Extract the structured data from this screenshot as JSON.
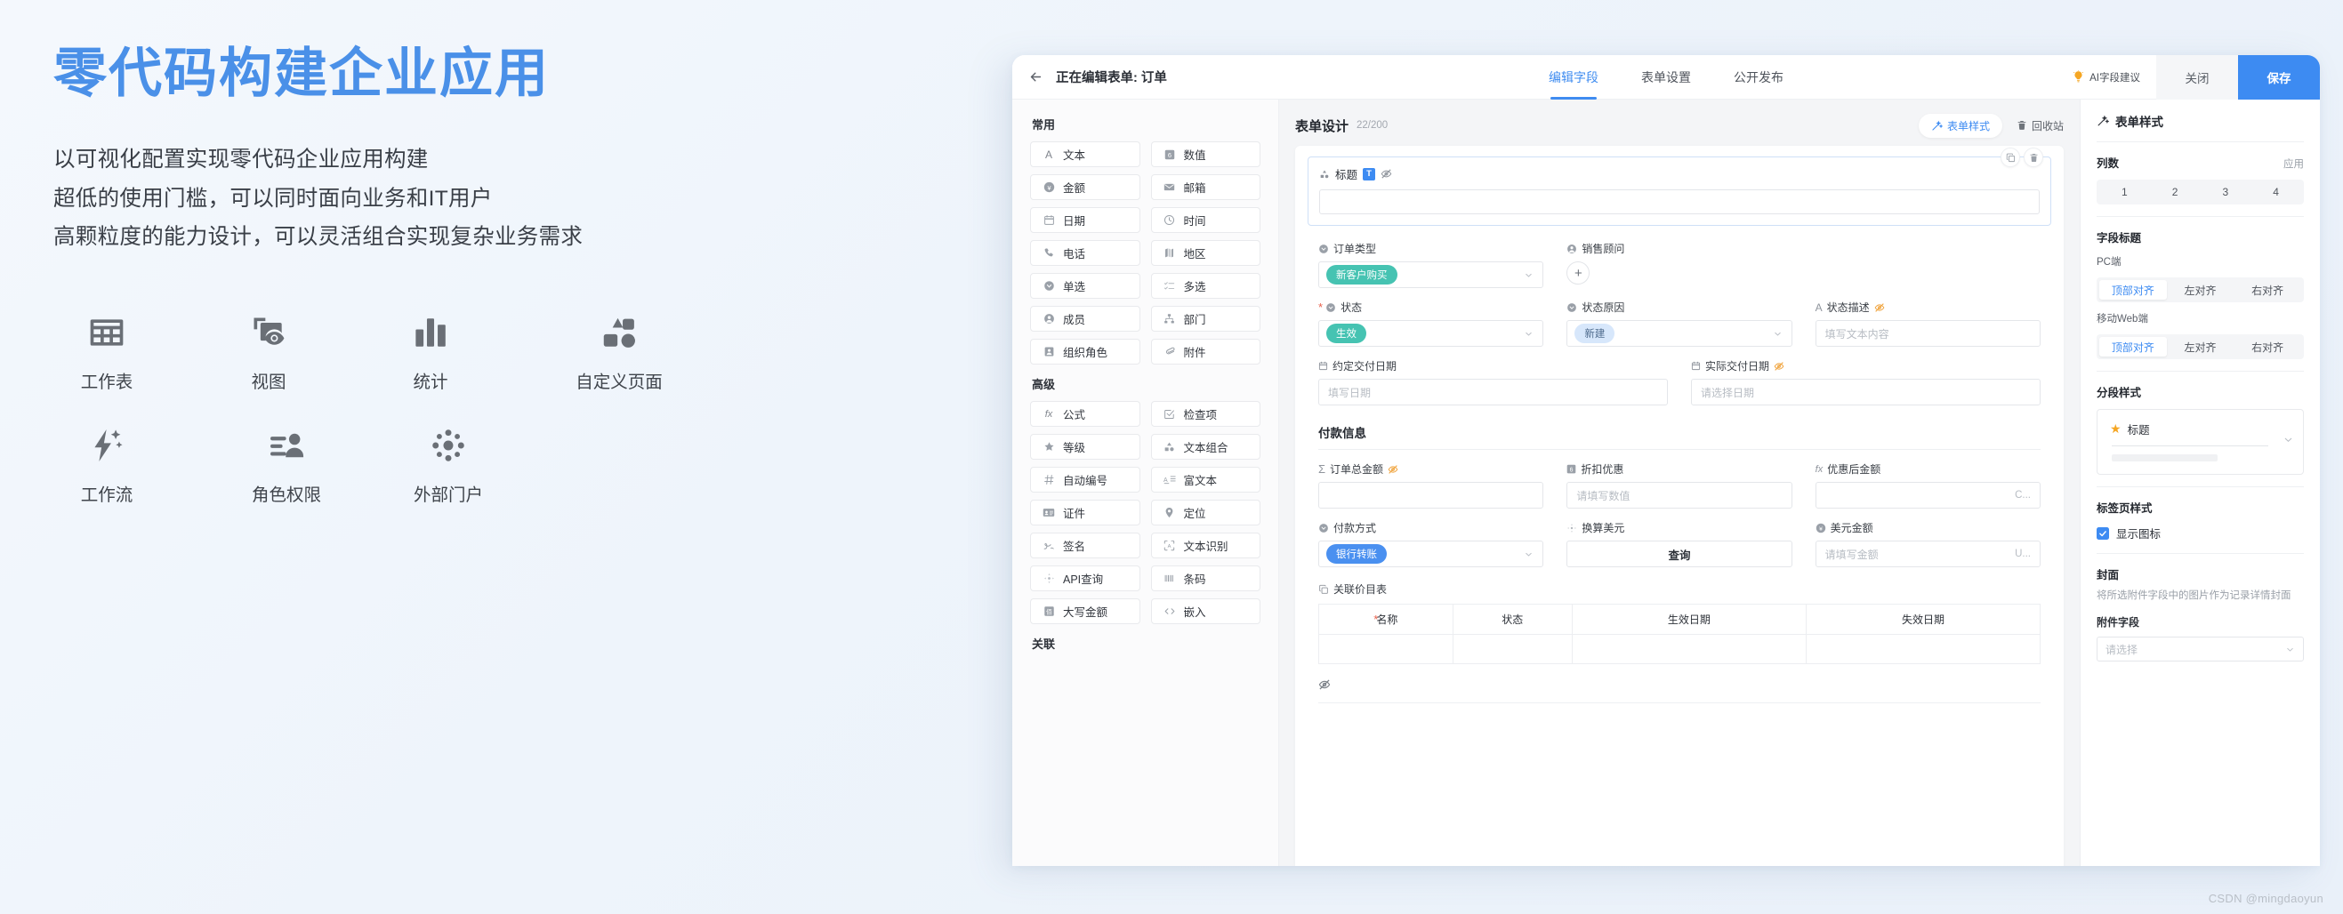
{
  "marketing": {
    "headline": "零代码构建企业应用",
    "sub_lines": [
      "以可视化配置实现零代码企业应用构建",
      "超低的使用门槛，可以同时面向业务和IT用户",
      "高颗粒度的能力设计，可以灵活组合实现复杂业务需求"
    ],
    "features": [
      {
        "icon": "worksheet-grid-icon",
        "label": "工作表"
      },
      {
        "icon": "view-eye-icon",
        "label": "视图"
      },
      {
        "icon": "statistics-bar-icon",
        "label": "统计"
      },
      {
        "icon": "custom-page-icon",
        "label": "自定义页面"
      },
      {
        "icon": "workflow-bolt-icon",
        "label": "工作流"
      },
      {
        "icon": "role-permission-icon",
        "label": "角色权限"
      },
      {
        "icon": "external-portal-icon",
        "label": "外部门户"
      }
    ]
  },
  "app": {
    "header": {
      "back_icon": "back-arrow-icon",
      "title": "正在编辑表单: 订单",
      "tabs": [
        {
          "label": "编辑字段",
          "active": true
        },
        {
          "label": "表单设置",
          "active": false
        },
        {
          "label": "公开发布",
          "active": false
        }
      ],
      "ai_suggest": "AI字段建议",
      "ai_icon": "lightbulb-icon",
      "close_label": "关闭",
      "save_label": "保存"
    },
    "palette": {
      "groups": [
        {
          "title": "常用",
          "items": [
            {
              "label": "文本",
              "icon": "letter-a-icon"
            },
            {
              "label": "数值",
              "icon": "number-box-icon"
            },
            {
              "label": "金额",
              "icon": "yuan-circle-icon"
            },
            {
              "label": "邮箱",
              "icon": "envelope-icon"
            },
            {
              "label": "日期",
              "icon": "calendar-icon"
            },
            {
              "label": "时间",
              "icon": "clock-icon"
            },
            {
              "label": "电话",
              "icon": "phone-icon"
            },
            {
              "label": "地区",
              "icon": "map-icon"
            },
            {
              "label": "单选",
              "icon": "radio-circle-icon"
            },
            {
              "label": "多选",
              "icon": "checklist-icon"
            },
            {
              "label": "成员",
              "icon": "user-circle-icon"
            },
            {
              "label": "部门",
              "icon": "org-tree-icon"
            },
            {
              "label": "组织角色",
              "icon": "id-person-icon"
            },
            {
              "label": "附件",
              "icon": "paperclip-icon"
            }
          ]
        },
        {
          "title": "高级",
          "items": [
            {
              "label": "公式",
              "icon": "fx-icon"
            },
            {
              "label": "检查项",
              "icon": "check-square-icon"
            },
            {
              "label": "等级",
              "icon": "star-icon"
            },
            {
              "label": "文本组合",
              "icon": "shapes-icon"
            },
            {
              "label": "自动编号",
              "icon": "hash-icon"
            },
            {
              "label": "富文本",
              "icon": "rich-text-icon"
            },
            {
              "label": "证件",
              "icon": "id-card-icon"
            },
            {
              "label": "定位",
              "icon": "location-pin-icon"
            },
            {
              "label": "签名",
              "icon": "signature-icon"
            },
            {
              "label": "文本识别",
              "icon": "ocr-scan-icon"
            },
            {
              "label": "API查询",
              "icon": "api-move-icon"
            },
            {
              "label": "条码",
              "icon": "barcode-icon"
            },
            {
              "label": "大写金额",
              "icon": "capital-amount-icon"
            },
            {
              "label": "嵌入",
              "icon": "code-embed-icon"
            }
          ]
        },
        {
          "title": "关联",
          "items": []
        }
      ]
    },
    "canvas": {
      "title": "表单设计",
      "count": "22/200",
      "form_style_btn": "表单样式",
      "form_style_icon": "magic-wand-icon",
      "recycle_btn": "回收站",
      "recycle_icon": "trash-icon",
      "title_block": {
        "label": "标题",
        "type_badge": "T",
        "hidden_icon": "eye-off-icon",
        "shapes_icon": "shapes-icon",
        "copy_icon": "copy-icon",
        "delete_icon": "trash-icon",
        "input_value": ""
      },
      "rows": [
        {
          "fields": [
            {
              "label": "订单类型",
              "icon": "radio-circle-icon",
              "control": "select",
              "tag": "新客户购买",
              "tag_color": "teal"
            },
            {
              "label": "销售顾问",
              "icon": "user-circle-icon",
              "control": "add-button",
              "add_label": "+"
            },
            {
              "label": "",
              "icon": "",
              "control": "empty"
            }
          ]
        },
        {
          "fields": [
            {
              "label": "状态",
              "icon": "radio-circle-icon",
              "control": "select",
              "tag": "生效",
              "tag_color": "teal",
              "required": true
            },
            {
              "label": "状态原因",
              "icon": "radio-circle-icon",
              "control": "select",
              "tag": "新建",
              "tag_color": "blue-light"
            },
            {
              "label": "状态描述",
              "icon": "letter-a-icon",
              "control": "input",
              "placeholder": "填写文本内容",
              "hidden": true
            }
          ]
        },
        {
          "fields": [
            {
              "label": "约定交付日期",
              "icon": "calendar-icon",
              "control": "input",
              "placeholder": "填写日期",
              "span": 2
            },
            {
              "label": "实际交付日期",
              "icon": "calendar-icon",
              "control": "input",
              "placeholder": "请选择日期",
              "hidden": true,
              "span": 2
            }
          ]
        }
      ],
      "payment_section": {
        "title": "付款信息",
        "rows": [
          {
            "fields": [
              {
                "label": "订单总金额",
                "icon": "sigma-icon",
                "control": "input",
                "placeholder": "",
                "hidden": true
              },
              {
                "label": "折扣优惠",
                "icon": "number-box-icon",
                "control": "input",
                "placeholder": "请填写数值"
              },
              {
                "label": "优惠后金额",
                "icon": "fx-icon",
                "control": "input",
                "placeholder": "",
                "suffix": "C..."
              }
            ]
          },
          {
            "fields": [
              {
                "label": "付款方式",
                "icon": "radio-circle-icon",
                "control": "select",
                "tag": "银行转账",
                "tag_color": "blue"
              },
              {
                "label": "换算美元",
                "icon": "api-move-icon",
                "control": "button",
                "button_label": "查询"
              },
              {
                "label": "美元金额",
                "icon": "yuan-circle-icon",
                "control": "input",
                "placeholder": "请填写金额",
                "suffix": "U..."
              }
            ]
          }
        ]
      },
      "related_table": {
        "label": "关联价目表",
        "icon": "related-table-icon",
        "columns": [
          "名称",
          "状态",
          "生效日期",
          "失效日期"
        ],
        "first_column_required": true,
        "empty_rows": 1
      },
      "bottom_hidden_icon": "eye-off-icon"
    },
    "style_panel": {
      "head": "表单样式",
      "head_icon": "magic-wand-icon",
      "columns": {
        "title": "列数",
        "apply": "应用",
        "options": [
          "1",
          "2",
          "3",
          "4"
        ],
        "selected": "1"
      },
      "field_title": {
        "title": "字段标题",
        "pc_label": "PC端",
        "pc_options": [
          "顶部对齐",
          "左对齐",
          "右对齐"
        ],
        "pc_selected": "顶部对齐",
        "mobile_label": "移动Web端",
        "mobile_options": [
          "顶部对齐",
          "左对齐",
          "右对齐"
        ],
        "mobile_selected": "顶部对齐"
      },
      "section_style": {
        "title": "分段样式",
        "preview_label": "标题",
        "preview_icon": "star-icon",
        "chevron_icon": "chevron-down-icon"
      },
      "tab_style": {
        "title": "标签页样式",
        "checkbox_label": "显示图标",
        "checked": true
      },
      "cover": {
        "title": "封面",
        "desc": "将所选附件字段中的图片作为记录详情封面",
        "field_label": "附件字段",
        "select_placeholder": "请选择"
      }
    }
  },
  "watermark": "CSDN @mingdaoyun"
}
